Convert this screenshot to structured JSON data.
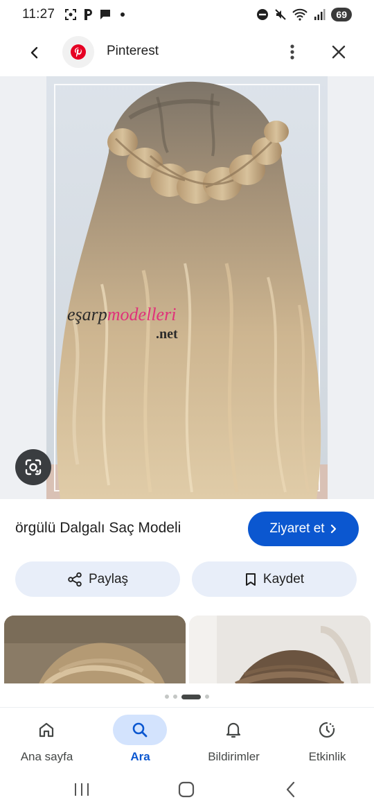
{
  "status_bar": {
    "time": "11:27",
    "battery": "69"
  },
  "header": {
    "source_name": "Pinterest",
    "logo_icon": "pinterest-logo",
    "brand_color": "#e60023"
  },
  "image": {
    "watermark_top": "eşarpmodelleri",
    "watermark_bottom": ".net"
  },
  "details": {
    "title": "örgülü Dalgalı Saç Modeli",
    "visit_label": "Ziyaret et",
    "share_label": "Paylaş",
    "save_label": "Kaydet",
    "accent_color": "#0b57d0"
  },
  "related": {
    "visible_count": 2
  },
  "pager": {
    "active_index": 2,
    "dot_count": 4
  },
  "bottom_nav": {
    "items": [
      {
        "label": "Ana sayfa",
        "icon": "home-icon",
        "active": false
      },
      {
        "label": "Ara",
        "icon": "search-icon",
        "active": true
      },
      {
        "label": "Bildirimler",
        "icon": "bell-icon",
        "active": false
      },
      {
        "label": "Etkinlik",
        "icon": "activity-icon",
        "active": false
      }
    ]
  }
}
